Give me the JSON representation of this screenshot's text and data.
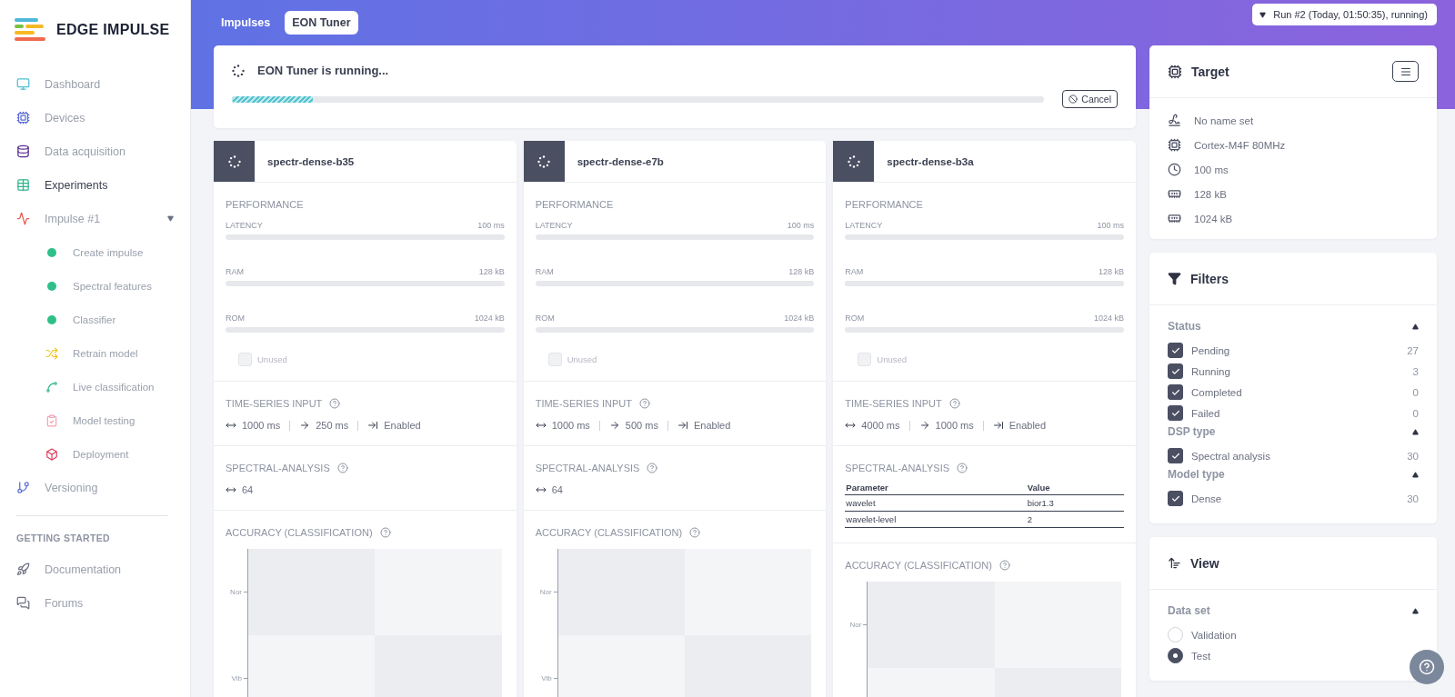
{
  "brand": {
    "name": "EDGE IMPULSE"
  },
  "sidebar": {
    "items": [
      {
        "label": "Dashboard",
        "selected": false
      },
      {
        "label": "Devices",
        "selected": false
      },
      {
        "label": "Data acquisition",
        "selected": false
      },
      {
        "label": "Experiments",
        "selected": true
      },
      {
        "label": "Impulse #1",
        "selected": false,
        "expanded": true,
        "children": [
          {
            "label": "Create impulse",
            "selected": false
          },
          {
            "label": "Spectral features",
            "selected": false
          },
          {
            "label": "Classifier",
            "selected": false
          },
          {
            "label": "Retrain model",
            "selected": false
          },
          {
            "label": "Live classification",
            "selected": false
          },
          {
            "label": "Model testing",
            "selected": false
          },
          {
            "label": "Deployment",
            "selected": false
          }
        ]
      },
      {
        "label": "Versioning",
        "selected": false
      }
    ],
    "section_title": "GETTING STARTED",
    "links": [
      {
        "label": "Documentation"
      },
      {
        "label": "Forums"
      }
    ]
  },
  "header": {
    "tabs": [
      {
        "label": "Impulses",
        "selected": false
      },
      {
        "label": "EON Tuner",
        "selected": true
      }
    ],
    "run_select": "Run #2 (Today, 01:50:35), running)"
  },
  "progress": {
    "title": "EON Tuner is running...",
    "level": 0.1,
    "cancel": "Cancel"
  },
  "results": [
    {
      "name": "spectr-dense-b35",
      "performance_title": "PERFORMANCE",
      "metrics": [
        {
          "label": "LATENCY",
          "value": "100 ms"
        },
        {
          "label": "RAM",
          "value": "128 kB"
        },
        {
          "label": "ROM",
          "value": "1024 kB"
        }
      ],
      "unused": {
        "label": "Unused",
        "checked": false
      },
      "time_series": {
        "title": "TIME-SERIES INPUT",
        "window": "1000 ms",
        "stride": "250 ms",
        "status": "Enabled"
      },
      "spectral": {
        "title": "SPECTRAL-ANALYSIS",
        "kind": "value",
        "value": "64"
      },
      "accuracy": {
        "title": "ACCURACY (CLASSIFICATION)",
        "labels": [
          "Nor",
          "Vib"
        ]
      }
    },
    {
      "name": "spectr-dense-e7b",
      "performance_title": "PERFORMANCE",
      "metrics": [
        {
          "label": "LATENCY",
          "value": "100 ms"
        },
        {
          "label": "RAM",
          "value": "128 kB"
        },
        {
          "label": "ROM",
          "value": "1024 kB"
        }
      ],
      "unused": {
        "label": "Unused",
        "checked": false
      },
      "time_series": {
        "title": "TIME-SERIES INPUT",
        "window": "1000 ms",
        "stride": "500 ms",
        "status": "Enabled"
      },
      "spectral": {
        "title": "SPECTRAL-ANALYSIS",
        "kind": "value",
        "value": "64"
      },
      "accuracy": {
        "title": "ACCURACY (CLASSIFICATION)",
        "labels": [
          "Nor",
          "Vib"
        ]
      }
    },
    {
      "name": "spectr-dense-b3a",
      "performance_title": "PERFORMANCE",
      "metrics": [
        {
          "label": "LATENCY",
          "value": "100 ms"
        },
        {
          "label": "RAM",
          "value": "128 kB"
        },
        {
          "label": "ROM",
          "value": "1024 kB"
        }
      ],
      "unused": {
        "label": "Unused",
        "checked": false
      },
      "time_series": {
        "title": "TIME-SERIES INPUT",
        "window": "4000 ms",
        "stride": "1000 ms",
        "status": "Enabled"
      },
      "spectral": {
        "title": "SPECTRAL-ANALYSIS",
        "kind": "table",
        "columns": [
          "Parameter",
          "Value"
        ],
        "rows": [
          [
            "wavelet",
            "bior1.3"
          ],
          [
            "wavelet-level",
            "2"
          ]
        ]
      },
      "accuracy": {
        "title": "ACCURACY (CLASSIFICATION)",
        "labels": [
          "Nor"
        ]
      }
    }
  ],
  "target": {
    "title": "Target",
    "items": [
      "No name set",
      "Cortex-M4F 80MHz",
      "100 ms",
      "128 kB",
      "1024 kB"
    ]
  },
  "filters": {
    "title": "Filters",
    "groups": [
      {
        "title": "Status",
        "expanded": true,
        "options": [
          {
            "label": "Pending",
            "count": "27",
            "checked": true
          },
          {
            "label": "Running",
            "count": "3",
            "checked": true
          },
          {
            "label": "Completed",
            "count": "0",
            "checked": true
          },
          {
            "label": "Failed",
            "count": "0",
            "checked": true
          }
        ]
      },
      {
        "title": "DSP type",
        "expanded": true,
        "options": [
          {
            "label": "Spectral analysis",
            "count": "30",
            "checked": true
          }
        ]
      },
      {
        "title": "Model type",
        "expanded": true,
        "options": [
          {
            "label": "Dense",
            "count": "30",
            "checked": true
          }
        ]
      }
    ]
  },
  "view": {
    "title": "View",
    "groups": [
      {
        "title": "Data set",
        "expanded": true,
        "options": [
          {
            "label": "Validation",
            "selected": false
          },
          {
            "label": "Test",
            "selected": true
          }
        ]
      }
    ]
  }
}
